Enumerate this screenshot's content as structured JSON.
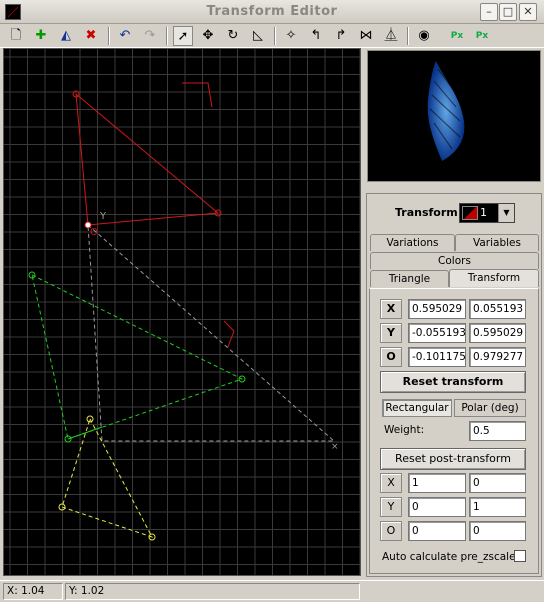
{
  "window": {
    "title": "Transform Editor"
  },
  "toolbar": {
    "icons": [
      "new-transform-icon",
      "add-transform-icon",
      "duplicate-transform-icon",
      "delete-transform-icon",
      "undo-icon",
      "redo-icon",
      "select-icon",
      "move-icon",
      "rotate-icon",
      "scale-icon",
      "flip-icon",
      "rotate-left-icon",
      "rotate-right-icon",
      "flip-horizontal-icon",
      "flip-vertical-icon",
      "show-variations-icon",
      "post-transform-icon",
      "reset-post-icon"
    ]
  },
  "canvas": {
    "origin_label": "O",
    "axis_label": "Y"
  },
  "panel": {
    "transform_label": "Transform",
    "transform_selected": "1",
    "tabs_row1": [
      "Variations",
      "Variables"
    ],
    "tabs_row2": [
      "Colors"
    ],
    "tabs_row3": [
      "Triangle",
      "Transform"
    ],
    "active_tab": "Transform",
    "pre": {
      "rows": [
        {
          "label": "X",
          "a": "0.595029",
          "b": "0.055193"
        },
        {
          "label": "Y",
          "a": "-0.055193",
          "b": "0.595029"
        },
        {
          "label": "O",
          "a": "-0.101175",
          "b": "0.979277"
        }
      ],
      "reset_label": "Reset transform"
    },
    "modes": {
      "rect": "Rectangular",
      "polar": "Polar (deg)",
      "active": "Rectangular"
    },
    "weight_label": "Weight:",
    "weight_value": "0.5",
    "post": {
      "reset_label": "Reset post-transform",
      "rows": [
        {
          "label": "X",
          "a": "1",
          "b": "0"
        },
        {
          "label": "Y",
          "a": "0",
          "b": "1"
        },
        {
          "label": "O",
          "a": "0",
          "b": "0"
        }
      ]
    },
    "auto_zscale_label": "Auto calculate pre_zscale",
    "auto_zscale_checked": false
  },
  "status": {
    "x": "X: 1.04",
    "y": "Y: 1.02"
  },
  "colors": {
    "selected_triangle": "#d01818",
    "triangle_green": "#22cc22",
    "triangle_yellow": "#e8e84a",
    "preview_fern": "#2a7fff"
  }
}
